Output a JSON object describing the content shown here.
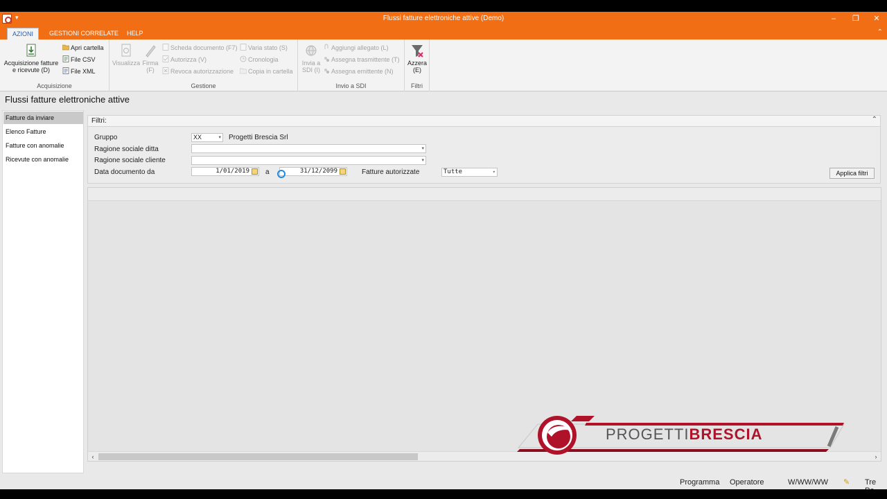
{
  "window": {
    "title": "Flussi fatture elettroniche attive  (Demo)",
    "controls": [
      "–",
      "❐",
      "✕"
    ]
  },
  "tabs": [
    "AZIONI",
    "GESTIONI CORRELATE",
    "HELP"
  ],
  "ribbon": {
    "acquisizione": {
      "label": "Acquisizione",
      "big_button": "Acquisizione fatture e ricevute (D)",
      "small": [
        "Apri cartella",
        "File CSV",
        "File XML"
      ]
    },
    "gestione": {
      "label": "Gestione",
      "visualizza": "Visualizza",
      "firma": "Firma (F)",
      "col1": [
        "Scheda documento (F7)",
        "Autorizza (V)",
        "Revoca autorizzazione"
      ],
      "col2": [
        "Varia stato (S)",
        "Cronologia",
        "Copia in cartella"
      ]
    },
    "invio": {
      "label": "Invio a SDI",
      "big_button": "Invia a SDI (I)",
      "small": [
        "Aggiungi allegato (L)",
        "Assegna trasmittente (T)",
        "Assegna emittente (N)"
      ]
    },
    "filtri": {
      "label": "Filtri",
      "big_button": "Azzera (E)"
    }
  },
  "page_title": "Flussi fatture elettroniche attive",
  "nav": {
    "items": [
      "Fatture da inviare",
      "Elenco Fatture",
      "Fatture con anomalie",
      "Ricevute con anomalie"
    ],
    "active_index": 0
  },
  "filters": {
    "header": "Filtri:",
    "gruppo_label": "Gruppo",
    "gruppo_value": "XX",
    "gruppo_desc": "Progetti Brescia Srl",
    "ragione_ditta_label": "Ragione sociale ditta",
    "ragione_ditta_value": "",
    "ragione_cliente_label": "Ragione sociale cliente",
    "ragione_cliente_value": "",
    "data_da_label": "Data documento da",
    "data_da_value": "1/01/2019",
    "a_label": "a",
    "data_a_value": "31/12/2099",
    "autorizzate_label": "Fatture autorizzate",
    "autorizzate_value": "Tutte",
    "apply_button": "Applica filtri"
  },
  "status": {
    "programma": "Programma",
    "operatore": "Operatore",
    "date": "W/WW/WW",
    "trailing": "Tre Pe"
  },
  "logo": {
    "part1": "PROGETTI",
    "part2": "BRESCIA"
  },
  "colors": {
    "accent": "#f26e14",
    "brand_red": "#b0122a",
    "tab_text": "#2a5db0"
  }
}
